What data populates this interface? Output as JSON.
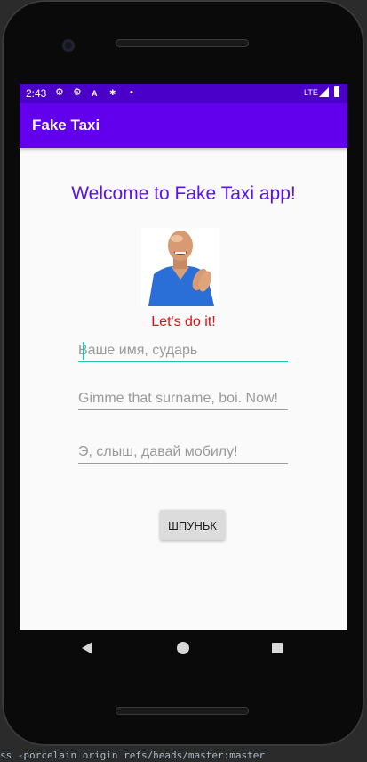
{
  "status_bar": {
    "time": "2:43",
    "network": "LTE",
    "icons": [
      "settings-icon",
      "settings-icon",
      "a-icon",
      "gear-small-icon",
      "dot-icon",
      "signal-icon",
      "battery-icon"
    ]
  },
  "app_bar": {
    "title": "Fake Taxi",
    "color": "#6200ee"
  },
  "main": {
    "welcome_text": "Welcome to Fake Taxi app!",
    "photo_alt": "smiling man in blue shirt",
    "slogan": "Let's do it!",
    "fields": [
      {
        "placeholder": "Ваше имя, сударь",
        "value": ""
      },
      {
        "placeholder": "Gimme that surname, boi. Now!",
        "value": ""
      },
      {
        "placeholder": "Э, слыш, давай мобилу!",
        "value": ""
      }
    ],
    "submit_label": "ШПУНЬК"
  },
  "ide_background_text": "ss -porcelain origin refs/heads/master:master"
}
